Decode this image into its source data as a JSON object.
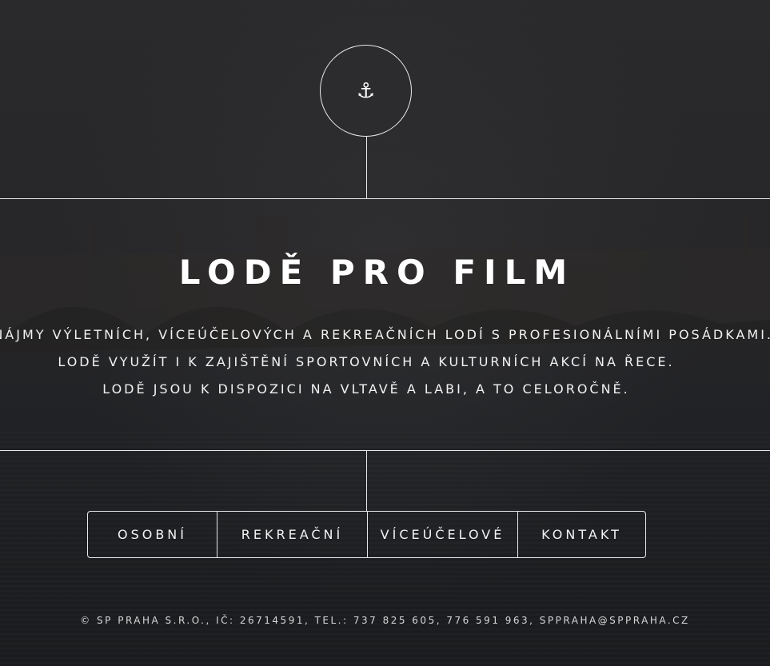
{
  "logo": {
    "icon": "anchor-icon",
    "glyph": "⚓"
  },
  "hero": {
    "title": "LODĚ PRO FILM",
    "lines": [
      "PRONÁJMY VÝLETNÍCH, VÍCEÚČELOVÝCH A REKREAČNÍCH LODÍ S PROFESIONÁLNÍMI POSÁDKAMI.",
      "LODĚ VYUŽÍT I K ZAJIŠTĚNÍ SPORTOVNÍCH A KULTURNÍCH AKCÍ NA ŘECE.",
      "LODĚ JSOU K DISPOZICI NA VLTAVĚ A LABI, A TO CELOROČNĚ."
    ]
  },
  "nav": {
    "items": [
      "OSOBNÍ",
      "REKREAČNÍ",
      "VÍCEÚČELOVÉ",
      "KONTAKT"
    ]
  },
  "footer": {
    "text": "© SP PRAHA S.R.O., IČ: 26714591, TEL.: 737 825 605, 776 591 963, SPPRAHA@SPPRAHA.CZ"
  },
  "colors": {
    "line": "#e8e8e8",
    "background": "#262628"
  }
}
